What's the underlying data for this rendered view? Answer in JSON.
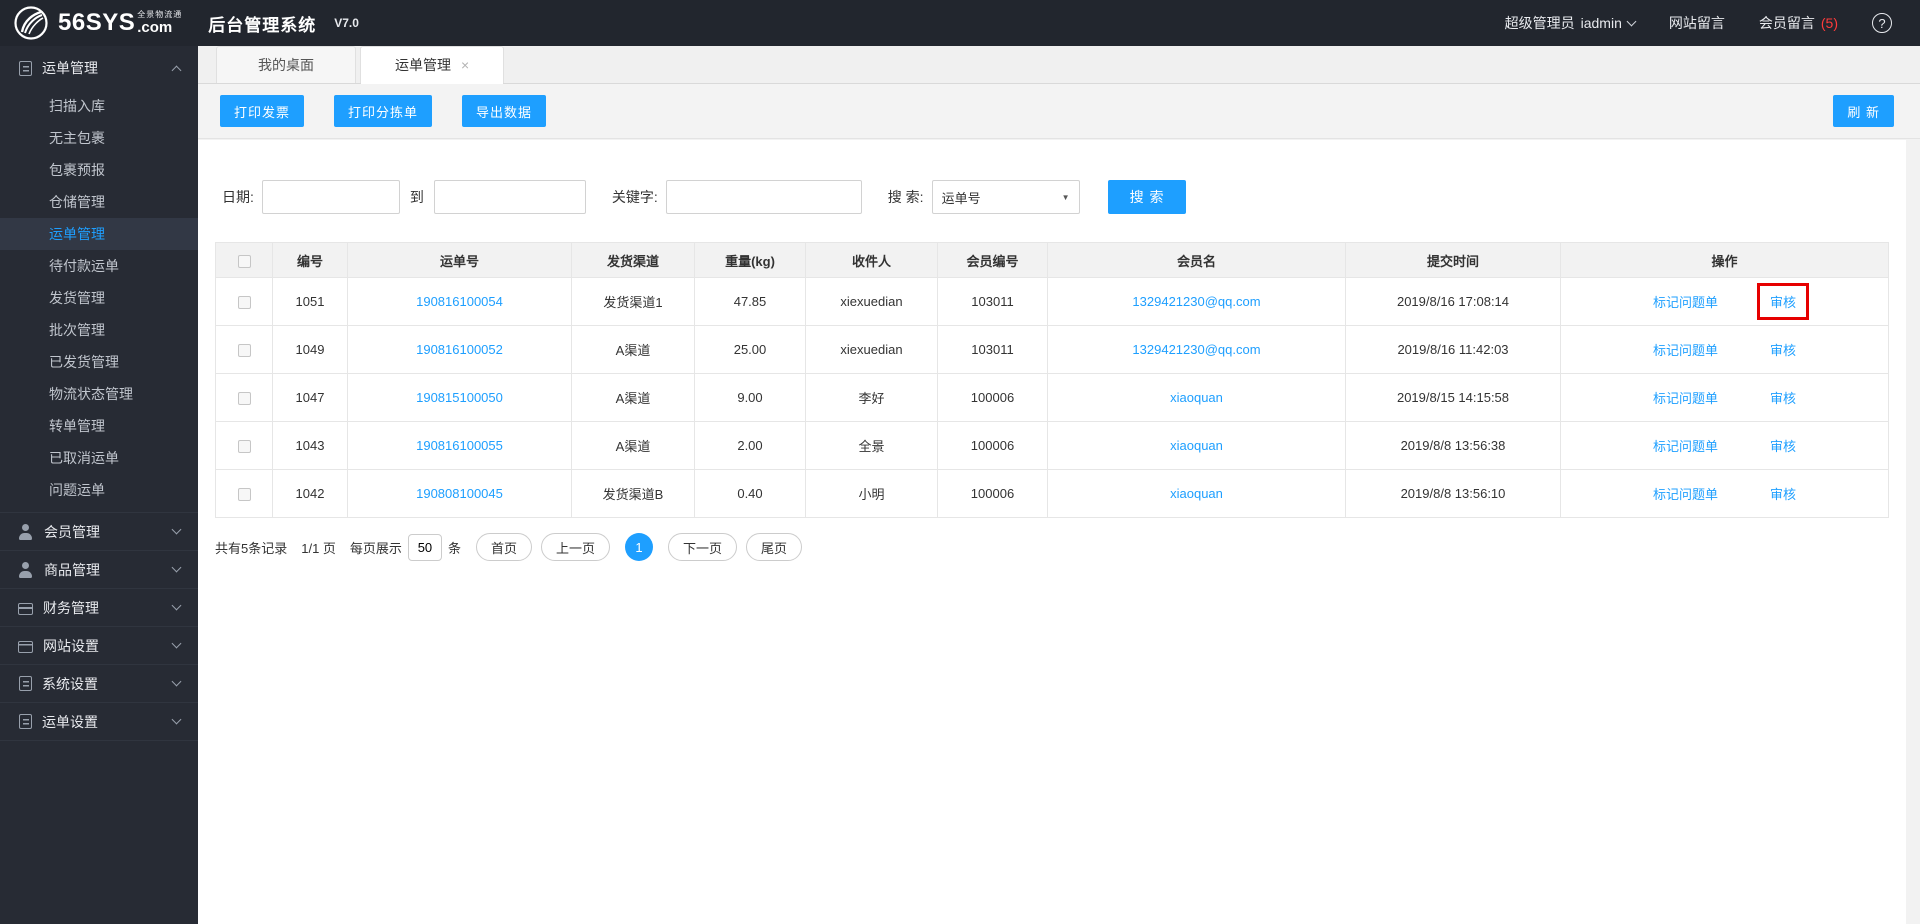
{
  "icons": {
    "close": "×",
    "help": "?",
    "dropdown_arrow": "▼"
  },
  "colors": {
    "accent": "#1E9FFF",
    "link": "#1E9FFF",
    "message_count_red": "#ff3b3b",
    "annotation_box_red": "#e60000"
  },
  "header": {
    "brand": {
      "name": "56SYS",
      "tagline": "全景物流通",
      "com": ".com"
    },
    "app_title": "后台管理系统",
    "version": "V7.0",
    "role": "超级管理员",
    "username": "iadmin",
    "site_messages": "网站留言",
    "member_messages": "会员留言",
    "member_message_count": "(5)"
  },
  "sidebar": {
    "groups": [
      {
        "label": "运单管理",
        "icon": "doc",
        "expanded": true,
        "items": [
          {
            "label": "扫描入库"
          },
          {
            "label": "无主包裹"
          },
          {
            "label": "包裹预报"
          },
          {
            "label": "仓储管理"
          },
          {
            "label": "运单管理",
            "active": true
          },
          {
            "label": "待付款运单"
          },
          {
            "label": "发货管理"
          },
          {
            "label": "批次管理"
          },
          {
            "label": "已发货管理"
          },
          {
            "label": "物流状态管理"
          },
          {
            "label": "转单管理"
          },
          {
            "label": "已取消运单"
          },
          {
            "label": "问题运单"
          }
        ]
      },
      {
        "label": "会员管理",
        "icon": "user",
        "expanded": false
      },
      {
        "label": "商品管理",
        "icon": "user",
        "expanded": false
      },
      {
        "label": "财务管理",
        "icon": "card",
        "expanded": false
      },
      {
        "label": "网站设置",
        "icon": "window",
        "expanded": false
      },
      {
        "label": "系统设置",
        "icon": "doc",
        "expanded": false
      },
      {
        "label": "运单设置",
        "icon": "doc",
        "expanded": false
      }
    ]
  },
  "tabs": [
    {
      "label": "我的桌面",
      "active": false,
      "closable": false
    },
    {
      "label": "运单管理",
      "active": true,
      "closable": true
    }
  ],
  "toolbar": {
    "buttons": [
      "打印发票",
      "打印分拣单",
      "导出数据"
    ],
    "refresh_label": "刷 新"
  },
  "filters": {
    "date_label": "日期:",
    "to_label": "到",
    "keyword_label": "关键字:",
    "search_type_label": "搜 索:",
    "search_type_value": "运单号",
    "search_button": "搜 索",
    "date_from_value": "",
    "date_to_value": "",
    "keyword_value": ""
  },
  "table": {
    "columns": [
      "编号",
      "运单号",
      "发货渠道",
      "重量(kg)",
      "收件人",
      "会员编号",
      "会员名",
      "提交时间",
      "操作"
    ],
    "rows": [
      {
        "id": "1051",
        "waybill": "190816100054",
        "channel": "发货渠道1",
        "weight": "47.85",
        "recipient": "xiexuedian",
        "member_id": "103011",
        "member_name": "1329421230@qq.com",
        "submitted": "2019/8/16 17:08:14",
        "mark_label": "标记问题单",
        "audit_label": "审核",
        "highlight_audit": true
      },
      {
        "id": "1049",
        "waybill": "190816100052",
        "channel": "A渠道",
        "weight": "25.00",
        "recipient": "xiexuedian",
        "member_id": "103011",
        "member_name": "1329421230@qq.com",
        "submitted": "2019/8/16 11:42:03",
        "mark_label": "标记问题单",
        "audit_label": "审核",
        "highlight_audit": false
      },
      {
        "id": "1047",
        "waybill": "190815100050",
        "channel": "A渠道",
        "weight": "9.00",
        "recipient": "李好",
        "member_id": "100006",
        "member_name": "xiaoquan",
        "submitted": "2019/8/15 14:15:58",
        "mark_label": "标记问题单",
        "audit_label": "审核",
        "highlight_audit": false
      },
      {
        "id": "1043",
        "waybill": "190816100055",
        "channel": "A渠道",
        "weight": "2.00",
        "recipient": "全景",
        "member_id": "100006",
        "member_name": "xiaoquan",
        "submitted": "2019/8/8 13:56:38",
        "mark_label": "标记问题单",
        "audit_label": "审核",
        "highlight_audit": false
      },
      {
        "id": "1042",
        "waybill": "190808100045",
        "channel": "发货渠道B",
        "weight": "0.40",
        "recipient": "小明",
        "member_id": "100006",
        "member_name": "xiaoquan",
        "submitted": "2019/8/8 13:56:10",
        "mark_label": "标记问题单",
        "audit_label": "审核",
        "highlight_audit": false
      }
    ]
  },
  "pagination": {
    "total_text": "共有5条记录",
    "page_text": "1/1 页",
    "per_page_prefix": "每页展示",
    "per_page_value": "50",
    "per_page_suffix": "条",
    "buttons_before": [
      "首页",
      "上一页"
    ],
    "current_page": "1",
    "buttons_after": [
      "下一页",
      "尾页"
    ]
  }
}
